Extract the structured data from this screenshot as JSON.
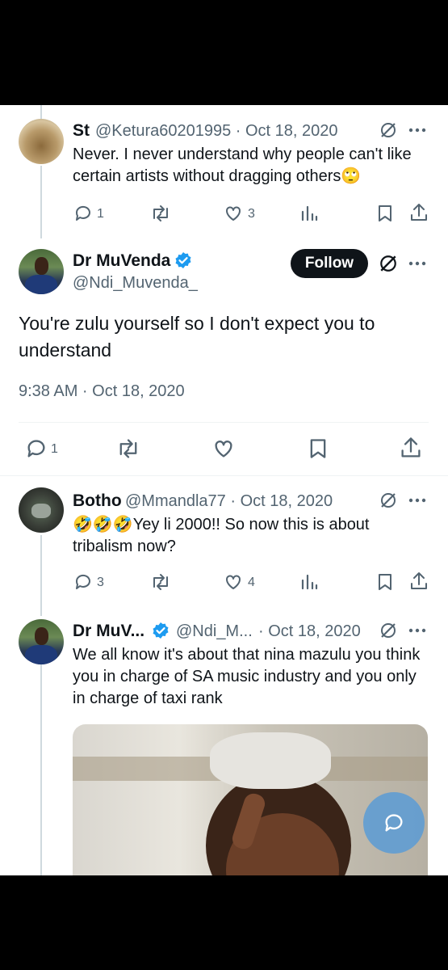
{
  "tweets": {
    "st": {
      "name": "St",
      "handle": "@Ketura60201995 · Oct 18, 2020",
      "text": "Never. I never understand why people can't like certain artists without dragging others🙄",
      "replies": "1",
      "likes": "3"
    },
    "main": {
      "name": "Dr MuVenda",
      "handle": "@Ndi_Muvenda_",
      "follow_label": "Follow",
      "text": "You're zulu yourself so I don't expect you to understand",
      "timestamp": "9:38 AM · Oct 18, 2020",
      "replies": "1"
    },
    "botho": {
      "name": "Botho",
      "handle": "@Mmandla77 · Oct 18, 2020",
      "text": "🤣🤣🤣Yey li 2000!! So now this is about tribalism now?",
      "replies": "3",
      "likes": "4"
    },
    "reply": {
      "name": "Dr MuV...",
      "handle": "@Ndi_M...",
      "date": "· Oct 18, 2020",
      "text": "We all know it's about that nina mazulu you think you in charge of SA music industry and you only in charge of taxi rank"
    }
  },
  "colors": {
    "verified": "#1d9bf0",
    "text_primary": "#0f1419",
    "text_secondary": "#536471",
    "fab": "#5b9bd5"
  },
  "icons": [
    "reply-icon",
    "retweet-icon",
    "like-icon",
    "views-icon",
    "bookmark-icon",
    "share-icon",
    "grok-icon",
    "more-icon",
    "verified-icon",
    "compose-icon"
  ]
}
